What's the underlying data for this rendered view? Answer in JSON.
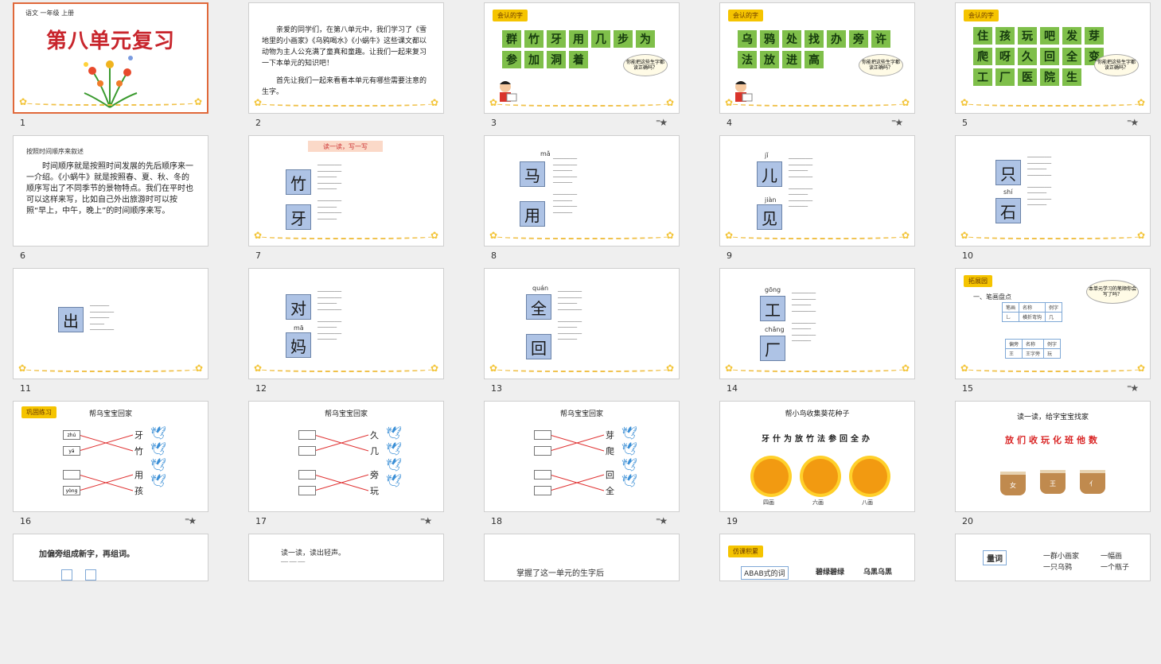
{
  "slides": [
    {
      "n": "1",
      "star": false,
      "header": "语文  一年级  上册",
      "title": "第八单元复习"
    },
    {
      "n": "2",
      "star": false,
      "p1": "亲爱的同学们，在第八单元中，我们学习了《雪地里的小画家》《乌鸦喝水》《小蜗牛》这些课文都以动物为主人公充满了童真和童趣。让我们一起来复习一下本单元的知识吧！",
      "p2": "首先让我们一起来看看本单元有哪些需要注意的生字。"
    },
    {
      "n": "3",
      "star": true,
      "tag": "会认的字",
      "chars": [
        "群",
        "竹",
        "牙",
        "用",
        "几",
        "步",
        "为",
        "参",
        "加",
        "洞",
        "着"
      ],
      "cloud": "你能把这些生字都读正确吗？"
    },
    {
      "n": "4",
      "star": true,
      "tag": "会认的字",
      "chars": [
        "乌",
        "鸦",
        "处",
        "找",
        "办",
        "旁",
        "许",
        "法",
        "放",
        "进",
        "高"
      ],
      "cloud": "你能把这些生字都读正确吗？"
    },
    {
      "n": "5",
      "star": true,
      "tag": "会认的字",
      "chars": [
        "住",
        "孩",
        "玩",
        "吧",
        "发",
        "芽",
        "爬",
        "呀",
        "久",
        "回",
        "全",
        "变",
        "工",
        "厂",
        "医",
        "院",
        "生"
      ],
      "cloud": "你能把这些生字都读正确吗？"
    },
    {
      "n": "6",
      "star": false,
      "small": "按照时间顺序来叙述",
      "p1": "时间顺序就是按照时间发展的先后顺序来一一介绍。《小蜗牛》就是按照春、夏、秋、冬的顺序写出了不同季节的景物特点。我们在平时也可以这样来写，比如自己外出旅游时可以按照“早上，中午，晚上”的时间顺序来写。"
    },
    {
      "n": "7",
      "star": false,
      "banner": "读一读，写一写",
      "c1": "竹",
      "c2": "牙"
    },
    {
      "n": "8",
      "star": false,
      "c1": "马",
      "c2": "用",
      "py1": "mǎ"
    },
    {
      "n": "9",
      "star": false,
      "c1": "儿",
      "c2": "见",
      "py1": "jǐ",
      "py2": "jiàn"
    },
    {
      "n": "10",
      "star": false,
      "c1": "只",
      "c2": "石",
      "py2": "shí"
    },
    {
      "n": "11",
      "star": false,
      "c1": "出"
    },
    {
      "n": "12",
      "star": false,
      "c1": "对",
      "c2": "妈",
      "py2": "mā"
    },
    {
      "n": "13",
      "star": false,
      "c1": "全",
      "c2": "回",
      "py1": "quán"
    },
    {
      "n": "14",
      "star": false,
      "c1": "工",
      "c2": "厂",
      "py1": "gōng",
      "py2": "chǎng"
    },
    {
      "n": "15",
      "star": true,
      "tag": "拓展园",
      "small": "一、笔画盘点",
      "cloud": "本单元学习的笔顺你会写了吗？",
      "t1": [
        "笔画",
        "名称",
        "例字"
      ],
      "t1r": [
        "乚",
        "横折弯钩",
        "几"
      ],
      "t2": [
        "偏旁",
        "名称",
        "例字"
      ],
      "t2r": [
        "王",
        "王字旁",
        "玩"
      ]
    },
    {
      "n": "16",
      "star": true,
      "tag": "巩固练习",
      "title": "帮乌宝宝回家",
      "left": [
        "zhú",
        "yá",
        "yòng"
      ],
      "right": [
        "牙",
        "竹",
        "用",
        "孩"
      ]
    },
    {
      "n": "17",
      "star": true,
      "title": "帮乌宝宝回家",
      "right": [
        "久",
        "几",
        "旁",
        "玩"
      ]
    },
    {
      "n": "18",
      "star": true,
      "title": "帮乌宝宝回家",
      "right": [
        "芽",
        "爬",
        "回",
        "全"
      ]
    },
    {
      "n": "19",
      "star": false,
      "title": "帮小鸟收集葵花种子",
      "row": "牙什为放竹法参回全办",
      "suns": [
        "四画",
        "六画",
        "八画"
      ]
    },
    {
      "n": "20",
      "star": false,
      "title": "读一读，给字宝宝找家",
      "row": "放们收玩化班他数",
      "cups": [
        "女",
        "王",
        "亻"
      ]
    },
    {
      "n": "",
      "star": false,
      "title": "加偏旁组成新字，再组词。"
    },
    {
      "n": "",
      "star": false,
      "title": "读一读，读出轻声。"
    },
    {
      "n": "",
      "star": false,
      "title": "掌握了这一单元的生字后"
    },
    {
      "n": "",
      "star": false,
      "tag": "仿课积累",
      "a": "ABAB式的词",
      "b": "碧绿碧绿",
      "c": "乌黑乌黑"
    },
    {
      "n": "",
      "star": false,
      "title": "量词",
      "l1": "一群小画家",
      "l2": "一只乌鸦",
      "r1": "一幅画",
      "r2": "一个瓶子"
    }
  ]
}
